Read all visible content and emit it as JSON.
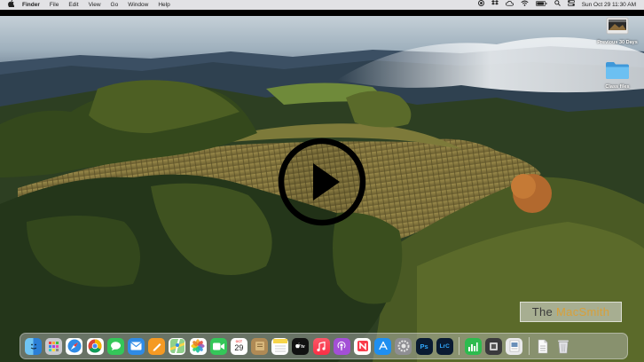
{
  "menubar": {
    "apple_icon": "apple-icon",
    "items": [
      "Finder",
      "File",
      "Edit",
      "View",
      "Go",
      "Window",
      "Help"
    ],
    "clock": "Sun Oct 29  11:30 AM",
    "status_icons": [
      "screen-record-icon",
      "dropbox-icon",
      "creative-cloud-icon",
      "wifi-icon",
      "battery-icon",
      "search-icon",
      "control-center-icon"
    ]
  },
  "desktop": {
    "items": [
      {
        "label": "Previous 30 Days",
        "icon": "screenshot-folder-icon"
      },
      {
        "label": "Class files",
        "icon": "folder-icon"
      }
    ]
  },
  "video": {
    "play_icon": "play-button-icon"
  },
  "watermark": {
    "part1": "The",
    "part2": "MacSmith"
  },
  "dock": {
    "calendar_day": "29",
    "calendar_month": "OCT",
    "apps": [
      "finder",
      "launchpad",
      "safari",
      "chrome",
      "messages",
      "mail",
      "pages",
      "maps",
      "photos",
      "facetime",
      "calendar",
      "notes-brown",
      "notes",
      "apple-tv",
      "music",
      "podcasts",
      "news",
      "app-store",
      "system-settings",
      "photoshop",
      "lightroom-classic",
      "numbers",
      "gpu-monitor",
      "preview",
      "document",
      "trash"
    ]
  },
  "colors": {
    "menubar": "#ebebee",
    "accent_gold": "#d8a03a",
    "folder_blue": "#5ab0ec"
  }
}
